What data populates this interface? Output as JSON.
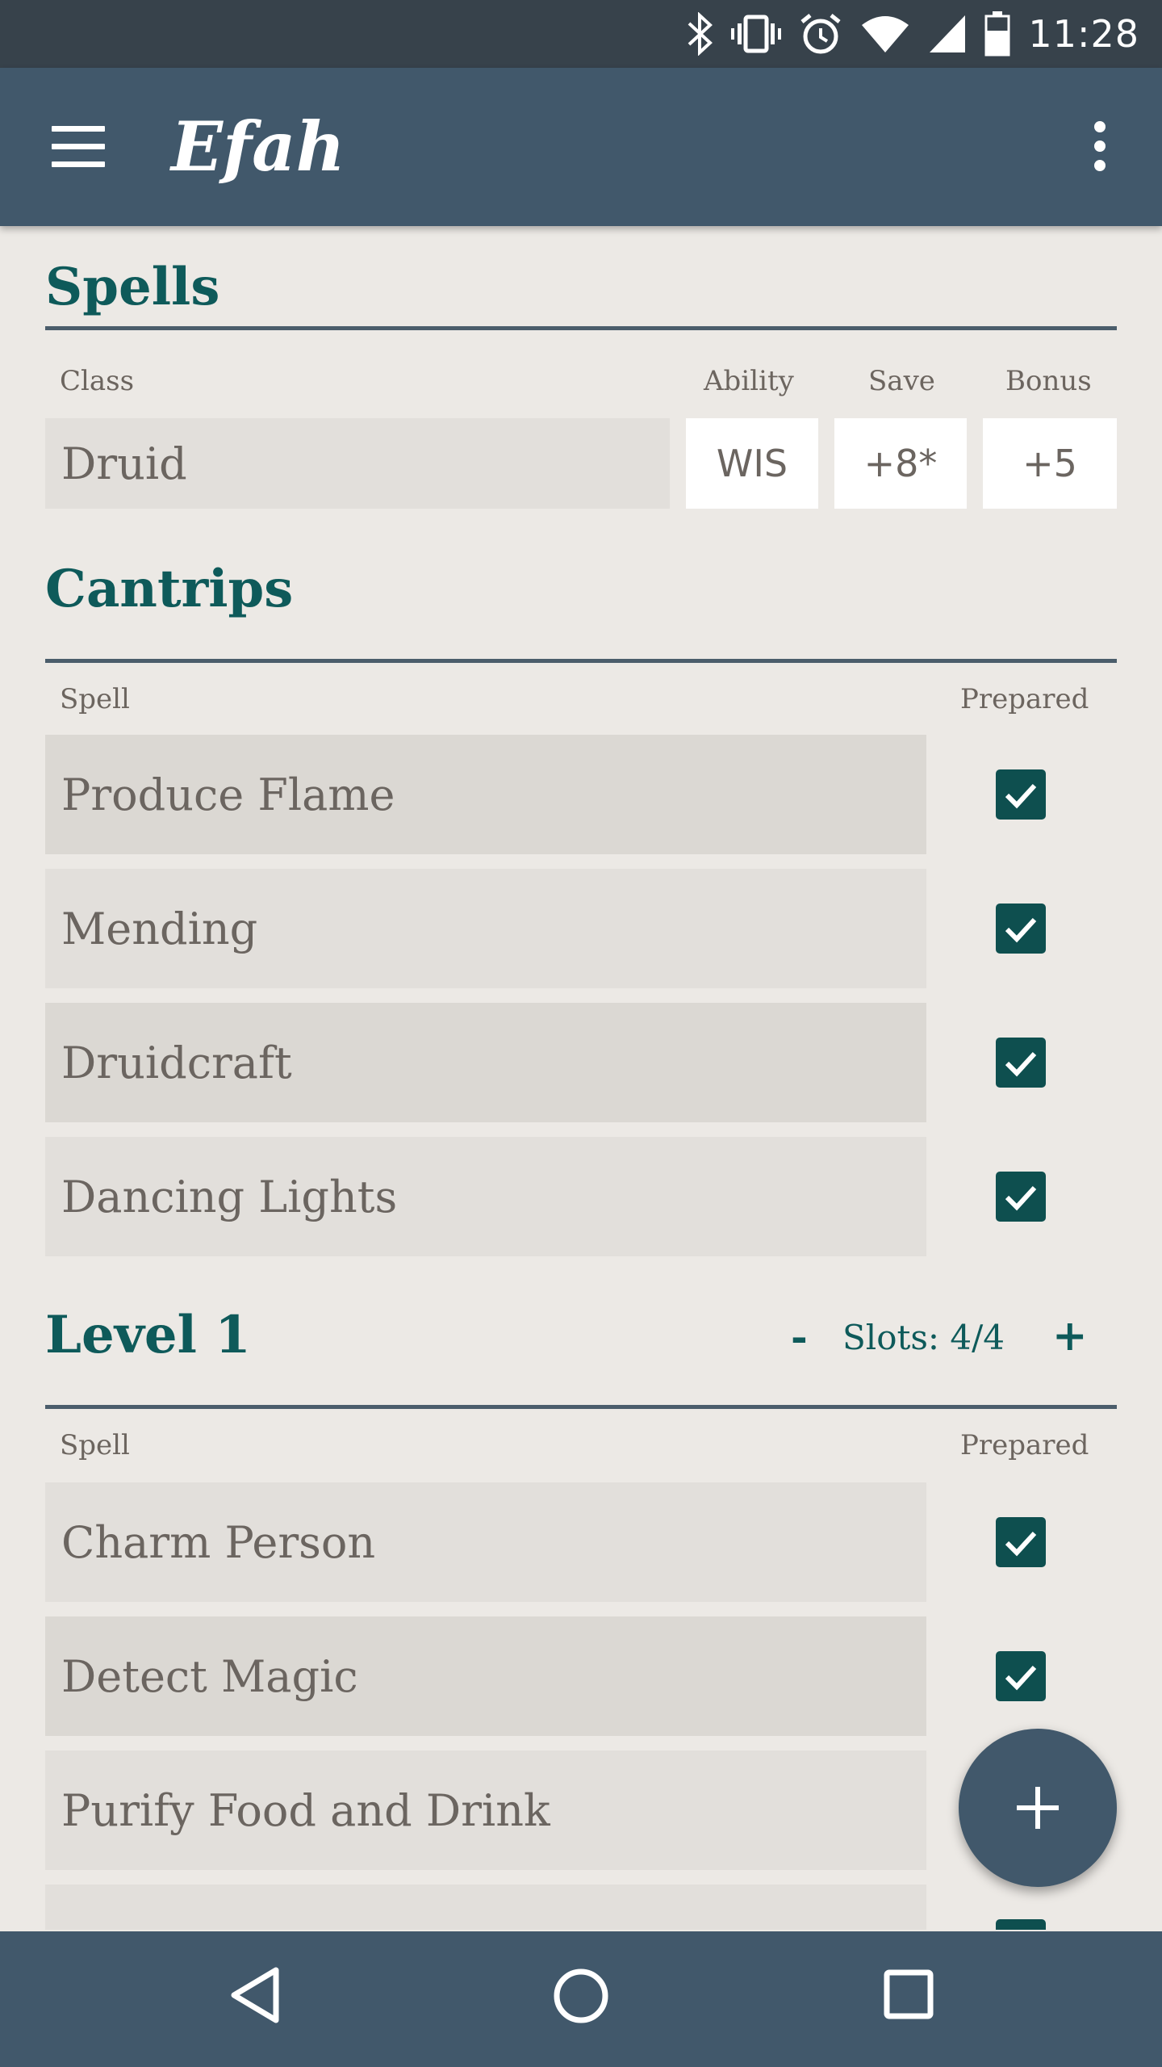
{
  "status_bar": {
    "time": "11:28"
  },
  "app_bar": {
    "title": "Efah"
  },
  "spells": {
    "title": "Spells",
    "labels": {
      "class": "Class",
      "ability": "Ability",
      "save": "Save",
      "bonus": "Bonus"
    },
    "class_value": "Druid",
    "ability_value": "WIS",
    "save_value": "+8*",
    "bonus_value": "+5"
  },
  "cantrips": {
    "title": "Cantrips",
    "labels": {
      "spell": "Spell",
      "prepared": "Prepared"
    },
    "items": [
      {
        "name": "Produce Flame",
        "prepared": true
      },
      {
        "name": "Mending",
        "prepared": true
      },
      {
        "name": "Druidcraft",
        "prepared": true
      },
      {
        "name": "Dancing Lights",
        "prepared": true
      }
    ]
  },
  "level1": {
    "title": "Level 1",
    "minus": "-",
    "slots": "Slots: 4/4",
    "plus": "+",
    "labels": {
      "spell": "Spell",
      "prepared": "Prepared"
    },
    "items": [
      {
        "name": "Charm Person",
        "prepared": true
      },
      {
        "name": "Detect Magic",
        "prepared": true
      },
      {
        "name": "Purify Food and Drink",
        "prepared": false
      },
      {
        "name": "",
        "prepared": true
      }
    ]
  },
  "fab": {
    "label": "+"
  },
  "icons": {
    "status": [
      "bluetooth-icon",
      "vibrate-icon",
      "alarm-icon",
      "wifi-icon",
      "signal-icon",
      "battery-icon"
    ],
    "nav": [
      "back-icon",
      "home-icon",
      "recents-icon"
    ]
  },
  "colors": {
    "status_bar": "#37424b",
    "app_bar": "#41586b",
    "accent": "#0e5a5a",
    "checkbox": "#0e4f4f",
    "background": "#ece9e5"
  }
}
